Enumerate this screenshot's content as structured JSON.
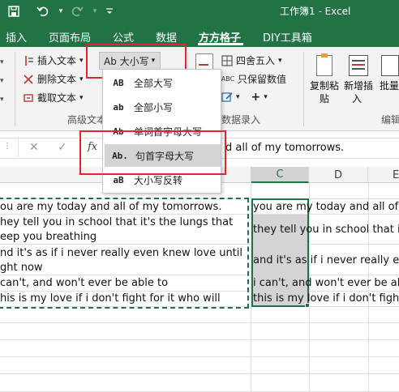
{
  "window": {
    "title": "工作簿1 - Excel"
  },
  "quick_access": {
    "icons": [
      "save-icon",
      "undo-icon",
      "redo-icon"
    ]
  },
  "ribbon_tabs": [
    "插入",
    "页面布局",
    "公式",
    "数据",
    "方方格子",
    "DIY工具箱"
  ],
  "active_tab": "方方格子",
  "ribbon": {
    "insert_text": "插入文本",
    "delete_text": "删除文本",
    "extract_text": "截取文本",
    "case_button": "Ab 大小写",
    "advanced_group": "高级文本",
    "round": "四舍五入",
    "keep_values": "只保留数值",
    "data_entry_group": "数据录入",
    "copy_paste": "复制粘",
    "copy_paste_2": "贴",
    "new_insert": "新增插",
    "new_insert_2": "入",
    "batch": "批量",
    "edit_group": "编辑"
  },
  "case_menu": {
    "items": [
      {
        "ab": "AB",
        "label": "全部大写"
      },
      {
        "ab": "ab",
        "label": "全部小写"
      },
      {
        "ab": "Ab",
        "label": "单词首字母大写"
      },
      {
        "ab": "Ab.",
        "label": "句首字母大写"
      },
      {
        "ab": "aB",
        "label": "大小写反转"
      }
    ],
    "highlighted_index": 3
  },
  "formula_bar": {
    "fx": "fx",
    "content": "d all of my tomorrows."
  },
  "columns": [
    "C",
    "D",
    "E"
  ],
  "sheet": {
    "col_b": [
      "ou are my today and all of my tomorrows.",
      "hey tell you in school that it's the lungs that",
      "eep you breathing",
      "nd it's as if i never really even knew love until",
      "ght now",
      "can't, and won't ever be able to",
      "his is my love if i don't fight for it who will"
    ],
    "col_c": [
      "you are my today and all of my tomorr",
      "they tell you in school that it's the lu",
      "and it's as if i never really even knew",
      "i can't, and won't ever be able to",
      "this is my love if i don't fight for it w"
    ]
  },
  "colors": {
    "excel_green": "#217346",
    "highlight_red": "#e0282b",
    "selection_gray": "#d4d4d4"
  }
}
